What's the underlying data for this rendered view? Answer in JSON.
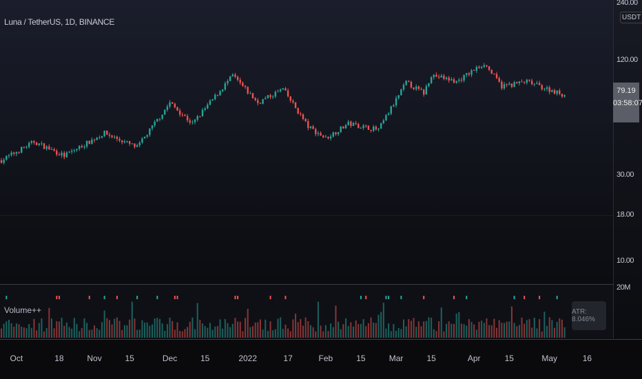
{
  "header": {
    "symbol_title": "Luna / TetherUS, 1D, BINANCE"
  },
  "indicator": {
    "name": "Volume++",
    "atr_label": "ATR: 8.046%",
    "volume_axis_label": "20M"
  },
  "price_axis": {
    "currency": "USDT",
    "last_price": "79.19",
    "countdown": "03:58:07",
    "labels": [
      "240.00",
      "120.00",
      "30.00",
      "18.00",
      "10.00"
    ]
  },
  "colors": {
    "up": "#26a69a",
    "down": "#ef5350",
    "background": "#131722"
  },
  "chart_data": {
    "type": "candlestick",
    "title": "Luna / TetherUS, 1D, BINANCE",
    "scale": "log",
    "start_date": "2021-09-25",
    "end_date": "2022-05-07",
    "ylim": [
      9,
      260
    ],
    "y_ticks": [
      240,
      120,
      30,
      18,
      10
    ],
    "close_anchors": [
      [
        "2021-09-25",
        36
      ],
      [
        "2021-10-08",
        45
      ],
      [
        "2021-10-20",
        38
      ],
      [
        "2021-11-05",
        50
      ],
      [
        "2021-11-18",
        42
      ],
      [
        "2021-12-01",
        72
      ],
      [
        "2021-12-10",
        56
      ],
      [
        "2021-12-26",
        100
      ],
      [
        "2022-01-05",
        72
      ],
      [
        "2022-01-15",
        85
      ],
      [
        "2022-01-25",
        54
      ],
      [
        "2022-02-01",
        47
      ],
      [
        "2022-02-10",
        56
      ],
      [
        "2022-02-22",
        52
      ],
      [
        "2022-03-05",
        92
      ],
      [
        "2022-03-12",
        81
      ],
      [
        "2022-03-15",
        101
      ],
      [
        "2022-03-25",
        93
      ],
      [
        "2022-04-05",
        116
      ],
      [
        "2022-04-12",
        88
      ],
      [
        "2022-04-22",
        93
      ],
      [
        "2022-05-07",
        79.19
      ]
    ],
    "x_ticks": [
      {
        "date": "2021-10-01",
        "label": "Oct"
      },
      {
        "date": "2021-10-18",
        "label": "18"
      },
      {
        "date": "2021-11-01",
        "label": "Nov"
      },
      {
        "date": "2021-11-15",
        "label": "15"
      },
      {
        "date": "2021-12-01",
        "label": "Dec"
      },
      {
        "date": "2021-12-15",
        "label": "15"
      },
      {
        "date": "2022-01-01",
        "label": "2022"
      },
      {
        "date": "2022-01-17",
        "label": "17"
      },
      {
        "date": "2022-02-01",
        "label": "Feb"
      },
      {
        "date": "2022-02-15",
        "label": "15"
      },
      {
        "date": "2022-03-01",
        "label": "Mar"
      },
      {
        "date": "2022-03-15",
        "label": "15"
      },
      {
        "date": "2022-04-01",
        "label": "Apr"
      },
      {
        "date": "2022-04-15",
        "label": "15"
      },
      {
        "date": "2022-05-01",
        "label": "May"
      },
      {
        "date": "2022-05-16",
        "label": "16"
      }
    ]
  }
}
